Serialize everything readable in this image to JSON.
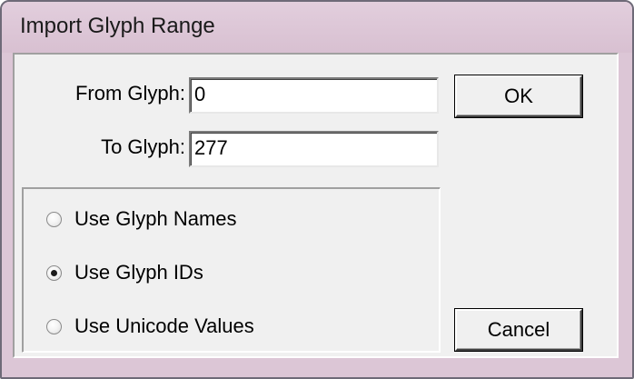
{
  "window": {
    "title": "Import Glyph Range"
  },
  "form": {
    "from_label": "From Glyph:",
    "from_value": "0",
    "to_label": "To Glyph:",
    "to_value": "277"
  },
  "options": {
    "selected": "Use Glyph IDs",
    "items": [
      {
        "label": "Use Glyph Names",
        "checked": false
      },
      {
        "label": "Use Glyph IDs",
        "checked": true
      },
      {
        "label": "Use Unicode Values",
        "checked": false
      }
    ]
  },
  "buttons": {
    "ok_label": "OK",
    "cancel_label": "Cancel"
  }
}
